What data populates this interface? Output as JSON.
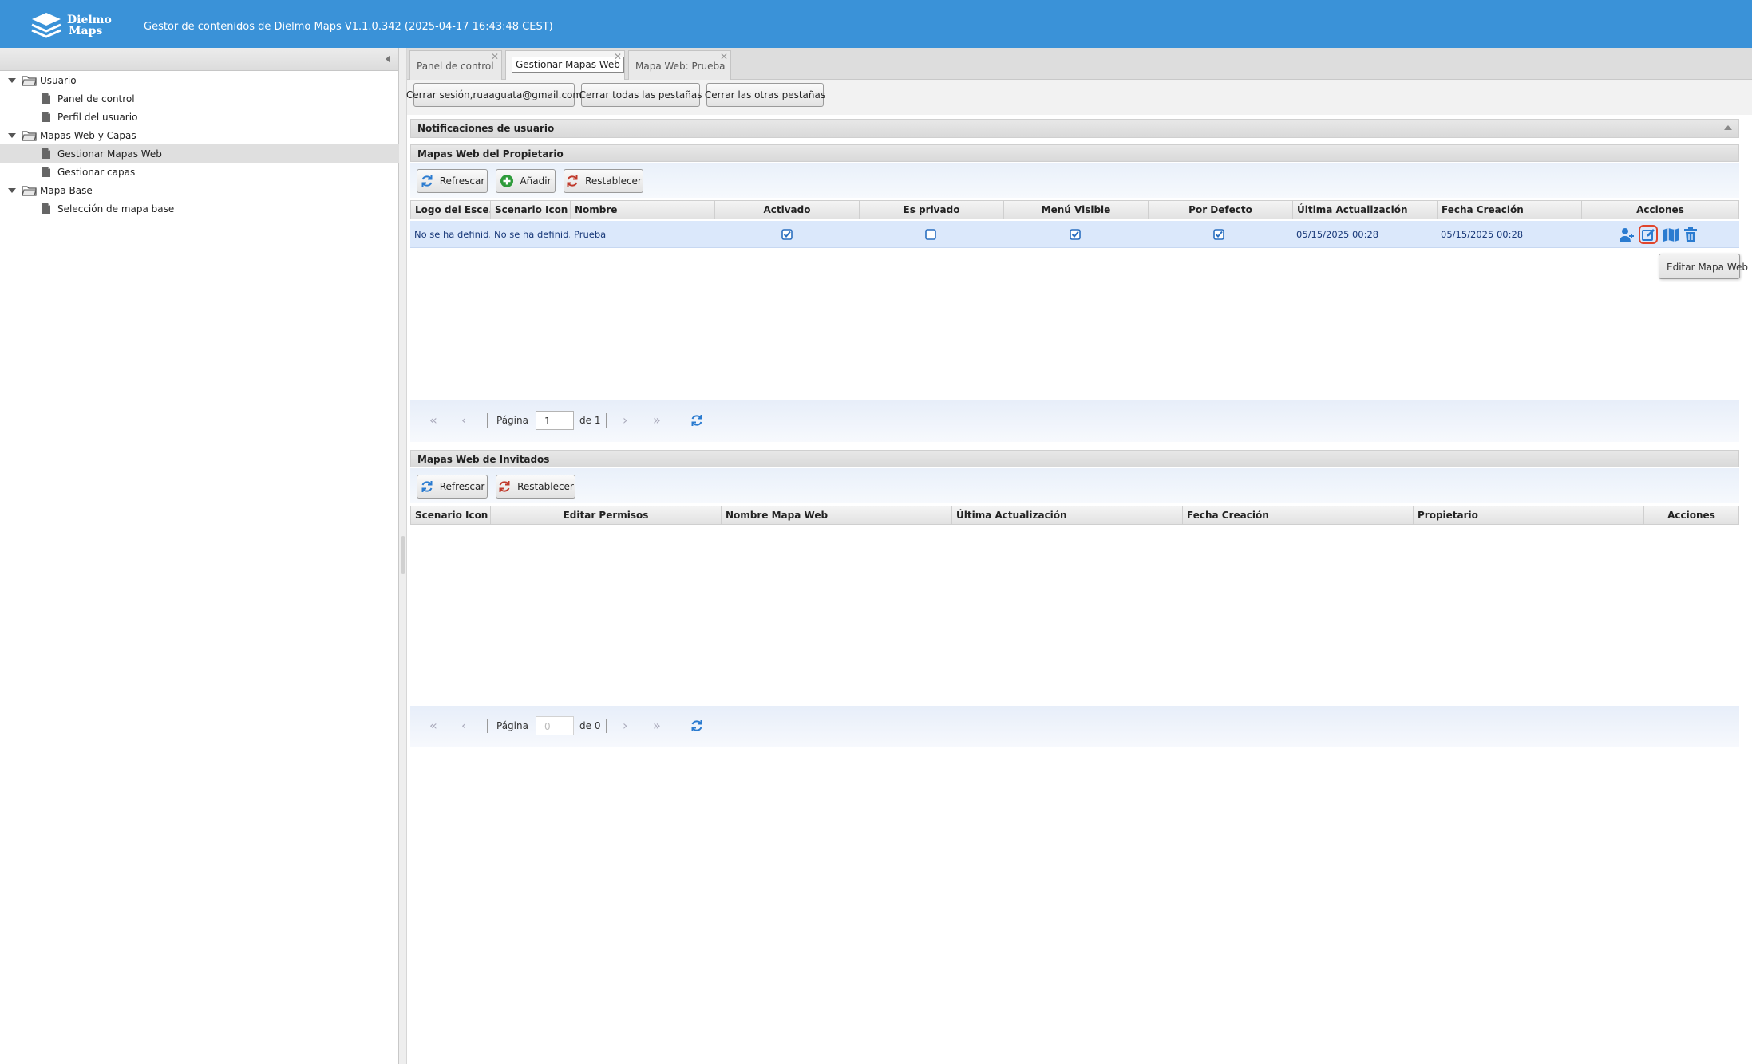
{
  "header": {
    "logo_line1": "Dielmo",
    "logo_line2": "Maps",
    "title": "Gestor de contenidos de Dielmo Maps V1.1.0.342 (2025-04-17 16:43:48 CEST)",
    "color": "#3a92d8"
  },
  "tree": {
    "items": [
      {
        "label": "Usuario",
        "type": "folder"
      },
      {
        "label": "Panel de control",
        "type": "doc"
      },
      {
        "label": "Perfil del usuario",
        "type": "doc"
      },
      {
        "label": "Mapas Web y Capas",
        "type": "folder"
      },
      {
        "label": "Gestionar Mapas Web",
        "type": "doc",
        "selected": true
      },
      {
        "label": "Gestionar capas",
        "type": "doc"
      },
      {
        "label": "Mapa Base",
        "type": "folder"
      },
      {
        "label": "Selección de mapa base",
        "type": "doc"
      }
    ]
  },
  "tabs": [
    {
      "label": "Panel de control"
    },
    {
      "label": "Gestionar Mapas Web",
      "active": true
    },
    {
      "label": "Mapa Web: Prueba"
    }
  ],
  "top_buttons": {
    "logout": "Cerrar sesión,ruaaguata@gmail.com",
    "close_all": "Cerrar todas las pestañas",
    "close_others": "Cerrar las otras pestañas"
  },
  "notifications": {
    "title": "Notificaciones de usuario"
  },
  "owner_maps": {
    "title": "Mapas Web del Propietario",
    "buttons": {
      "refresh": "Refrescar",
      "add": "Añadir",
      "reset": "Restablecer"
    },
    "columns": [
      "Logo del Esce...",
      "Scenario Icon",
      "Nombre",
      "Activado",
      "Es privado",
      "Menú Visible",
      "Por Defecto",
      "Última Actualización",
      "Fecha Creación",
      "Acciones"
    ],
    "rows": [
      {
        "logo": "No se ha definid...",
        "scenario_icon": "No se ha definid...",
        "name": "Prueba",
        "activado": true,
        "es_privado": false,
        "menu_visible": true,
        "por_defecto": true,
        "updated": "05/15/2025 00:28",
        "created": "05/15/2025 00:28"
      }
    ],
    "pager": {
      "page_label": "Página",
      "page_value": "1",
      "of_label": "de 1"
    },
    "tooltip": "Editar Mapa Web"
  },
  "guest_maps": {
    "title": "Mapas Web de Invitados",
    "buttons": {
      "refresh": "Refrescar",
      "reset": "Restablecer"
    },
    "columns": [
      "Scenario Icon",
      "Editar Permisos",
      "Nombre Mapa Web",
      "Última Actualización",
      "Fecha Creación",
      "Propietario",
      "Acciones"
    ],
    "pager": {
      "page_label": "Página",
      "page_value": "0",
      "of_label": "de 0"
    }
  }
}
